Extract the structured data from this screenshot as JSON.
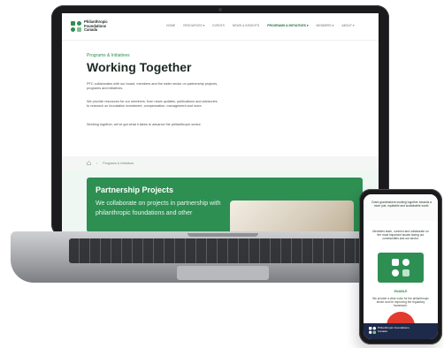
{
  "site": {
    "logo_text": "Philanthropic Foundations Canada",
    "nav": [
      "HOME",
      "RESOURCES ▾",
      "EVENTS",
      "NEWS & INSIGHTS",
      "PROGRAMS & INITIATIVES ▾",
      "MEMBERS ▾",
      "ABOUT ▾"
    ],
    "nav_active_index": 4,
    "eyebrow": "Programs & Initiatives",
    "title": "Working Together",
    "paragraphs": [
      "PFC collaborates with our board, members and the wider sector on partnership projects, programs and initiatives.",
      "We provide resources for our members: from news updates, publications and advisories to research on foundation investment, compensation, management and more.",
      "Working together, we've got what it takes to advance the philanthropic sector."
    ],
    "breadcrumb_current": "Programs & Initiatives",
    "card": {
      "title": "Partnership Projects",
      "text": "We collaborate on projects in partnership with philanthropic foundations and other"
    }
  },
  "phone": {
    "top_text": "Grant grantmakers working together towards a more just, equitable and sustainable world.",
    "mid_text": "Members learn, connect and collaborate on the most important issues facing our communities and our sector.",
    "enable_label": "ENABLE",
    "enable_text": "We provide a clear voice for the philanthropic sector and for improving the regulatory framework.",
    "footer_text": "Philanthropic Foundations Canada"
  },
  "colors": {
    "brand_green": "#2e8f52",
    "dark_text": "#1c2a22",
    "accent_red": "#e23a2e",
    "footer_navy": "#1e2a4a"
  }
}
